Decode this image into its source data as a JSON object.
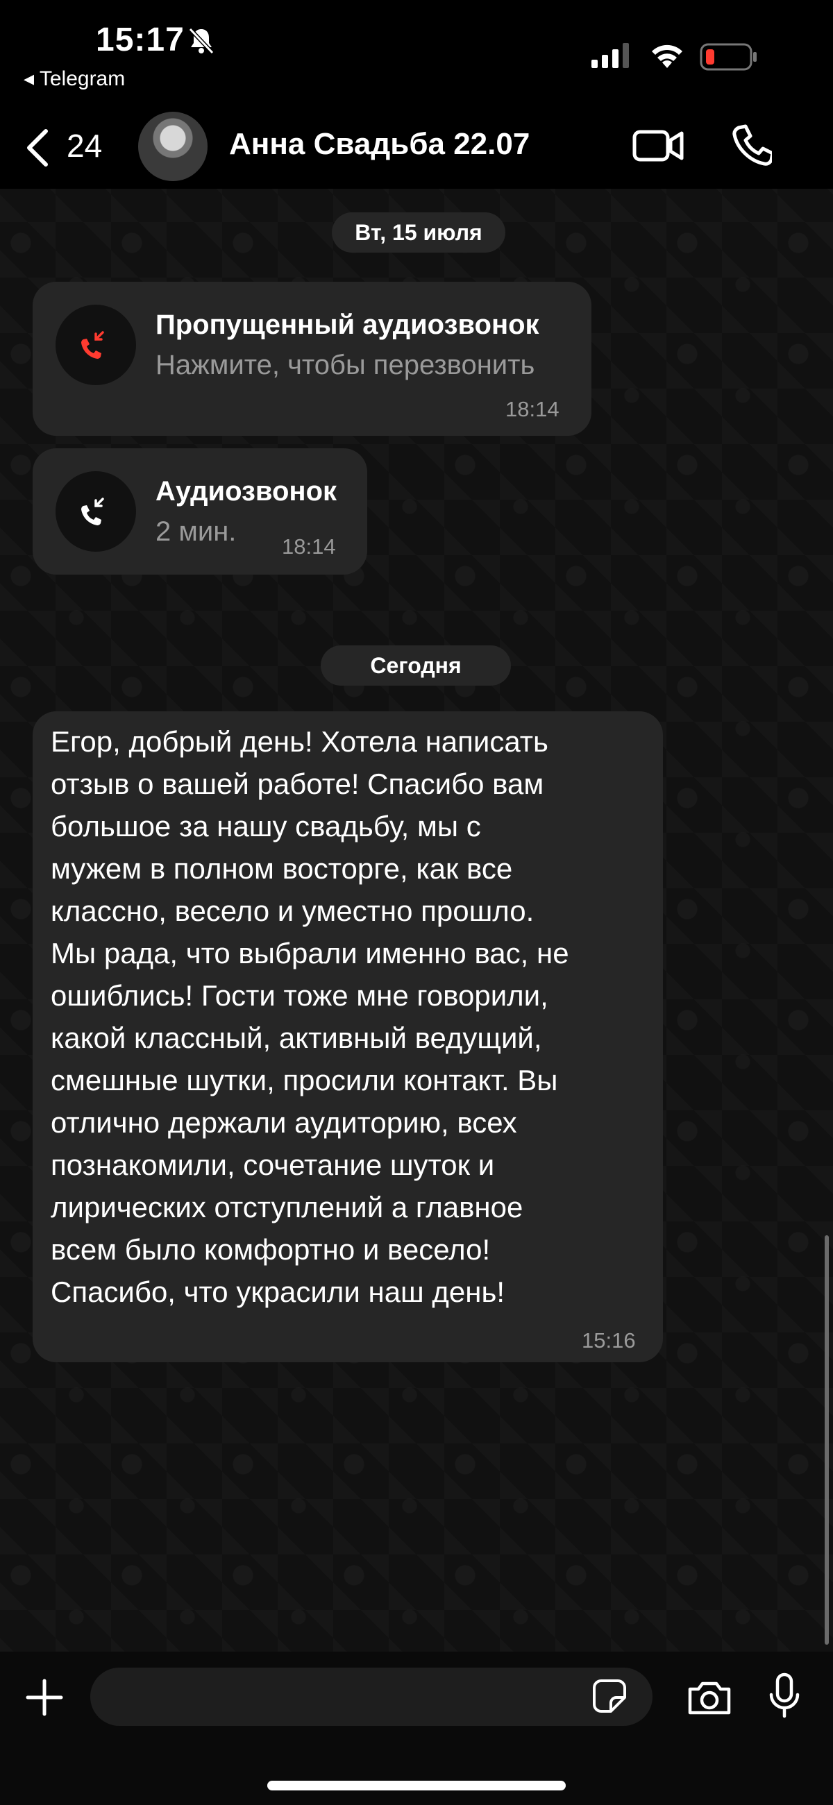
{
  "status_bar": {
    "time": "15:17",
    "back_app": "◂ Telegram"
  },
  "header": {
    "unread_count": "24",
    "chat_title": "Анна Свадьба 22.07"
  },
  "date_separators": [
    "Вт, 15 июля",
    "Сегодня"
  ],
  "calls": [
    {
      "title": "Пропущенный аудиозвонок",
      "subtitle": "Нажмите, чтобы перезвонить",
      "time": "18:14",
      "status_color": "#ff3b30"
    },
    {
      "title": "Аудиозвонок",
      "subtitle": "2 мин.",
      "time": "18:14",
      "status_color": "#ffffff"
    }
  ],
  "message": {
    "text": "Егор, добрый день! Хотела написать\nотзыв о вашей работе! Спасибо вам\nбольшое за нашу свадьбу, мы с\nмужем в полном восторге, как все\nклассно, весело и уместно прошло.\nМы рада, что выбрали именно вас, не\nошиблись! Гости тоже мне говорили,\nкакой классный, активный ведущий,\nсмешные шутки, просили контакт. Вы\nотлично держали аудиторию, всех\nпознакомили, сочетание шуток и\nлирических отступлений а главное\nвсем было комфортно и весело!\nСпасибо, что украсили наш день!",
    "time": "15:16"
  },
  "input": {
    "placeholder": ""
  },
  "icons": {
    "bell": "bell-slash-icon",
    "signal": "signal-icon",
    "wifi": "wifi-icon",
    "battery": "battery-icon",
    "back": "chevron-left-icon",
    "video": "video-camera-icon",
    "phone": "phone-icon",
    "plus": "plus-icon",
    "sticker": "sticker-icon",
    "camera": "camera-icon",
    "mic": "microphone-icon"
  },
  "colors": {
    "background": "#0d0d0d",
    "bubble": "#262626",
    "missed": "#ff3b30",
    "battery_low": "#ff3b30"
  }
}
